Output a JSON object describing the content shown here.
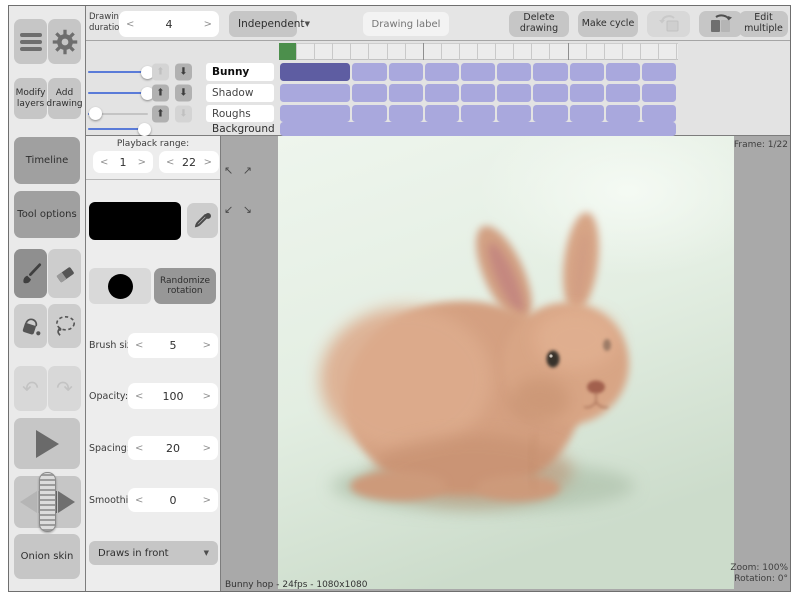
{
  "icons": {
    "caret": "▼",
    "up_arrow": "⬆",
    "down_arrow": "⬇",
    "undo": "↶",
    "redo": "↷",
    "expand_top": "↖ ↗",
    "expand_bottom": "↙ ↘"
  },
  "topbar": {
    "drawing_duration_label": "Drawing duration:",
    "duration_stepper": {
      "dec": "<",
      "value": "4",
      "inc": ">"
    },
    "independent_dropdown": {
      "label": "Independent"
    },
    "drawing_label_placeholder": "Drawing label",
    "delete_drawing_label": "Delete drawing",
    "make_cycle_label": "Make cycle",
    "edit_multiple_label": "Edit multiple"
  },
  "sidebar": {
    "modify_layers_label": "Modify layers",
    "add_drawing_label": "Add drawing",
    "timeline_label": "Timeline",
    "tool_options_label": "Tool options",
    "onion_skin_label": "Onion skin"
  },
  "timeline": {
    "frames_total": 22,
    "frame_width": 18.1,
    "playhead_frame": 1,
    "major_tick_after_frames": [
      8,
      16
    ],
    "layers": [
      {
        "name": "Bunny",
        "selected": true,
        "opacity": 1.0,
        "has_move_buttons": true,
        "up_enabled": false,
        "down_enabled": true,
        "boxed": true,
        "drawings": [
          4,
          2,
          2,
          2,
          2,
          2,
          2,
          2,
          2,
          2
        ],
        "selected_drawing": 0
      },
      {
        "name": "Shadow",
        "selected": false,
        "opacity": 1.0,
        "has_move_buttons": true,
        "up_enabled": true,
        "down_enabled": true,
        "boxed": true,
        "drawings": [
          4,
          2,
          2,
          2,
          2,
          2,
          2,
          2,
          2,
          2
        ],
        "selected_drawing": -1
      },
      {
        "name": "Roughs",
        "selected": false,
        "opacity": 0.13,
        "has_move_buttons": true,
        "up_enabled": true,
        "down_enabled": false,
        "boxed": true,
        "drawings": [
          4,
          2,
          2,
          2,
          2,
          2,
          2,
          2,
          2,
          2
        ],
        "selected_drawing": -1
      },
      {
        "name": "Background",
        "selected": false,
        "opacity": 0.95,
        "has_move_buttons": false,
        "up_enabled": false,
        "down_enabled": false,
        "boxed": false,
        "drawings": [
          22
        ],
        "selected_drawing": -1
      }
    ]
  },
  "tool_panel": {
    "playback_range_label": "Playback range:",
    "range_start_stepper": {
      "dec": "<",
      "value": "1",
      "inc": ">"
    },
    "range_end_stepper": {
      "dec": "<",
      "value": "22",
      "inc": ">"
    },
    "current_color": "#000000",
    "randomize_rotation_label": "Randomize rotation",
    "brush_size": {
      "label": "Brush size:",
      "dec": "<",
      "value": "5",
      "inc": ">"
    },
    "opacity": {
      "label": "Opacity:",
      "dec": "<",
      "value": "100",
      "inc": ">"
    },
    "spacing": {
      "label": "Spacing:",
      "dec": "<",
      "value": "20",
      "inc": ">"
    },
    "smoothing": {
      "label": "Smoothing:",
      "dec": "<",
      "value": "0",
      "inc": ">"
    },
    "draw_order_dropdown": {
      "label": "Draws in front"
    }
  },
  "canvas": {
    "frame_indicator": "Frame: 1/22",
    "project_info": "Bunny hop - 24fps - 1080x1080",
    "zoom_indicator": "Zoom: 100%",
    "rotation_indicator": "Rotation: 0°"
  },
  "colors": {
    "track_segment": "#a9a8dd",
    "track_segment_selected": "#5e5da2",
    "playhead_green": "#4c8f4c",
    "slider_blue": "#5a7bd8",
    "canvas_mint_top": "#eef5ed",
    "canvas_mint_bottom": "#ccdccb",
    "bunny_body": "#d4a081",
    "bunny_ear_inner": "#c2847f",
    "bunny_eye": "#38302a",
    "bunny_nose": "#a2604e"
  }
}
